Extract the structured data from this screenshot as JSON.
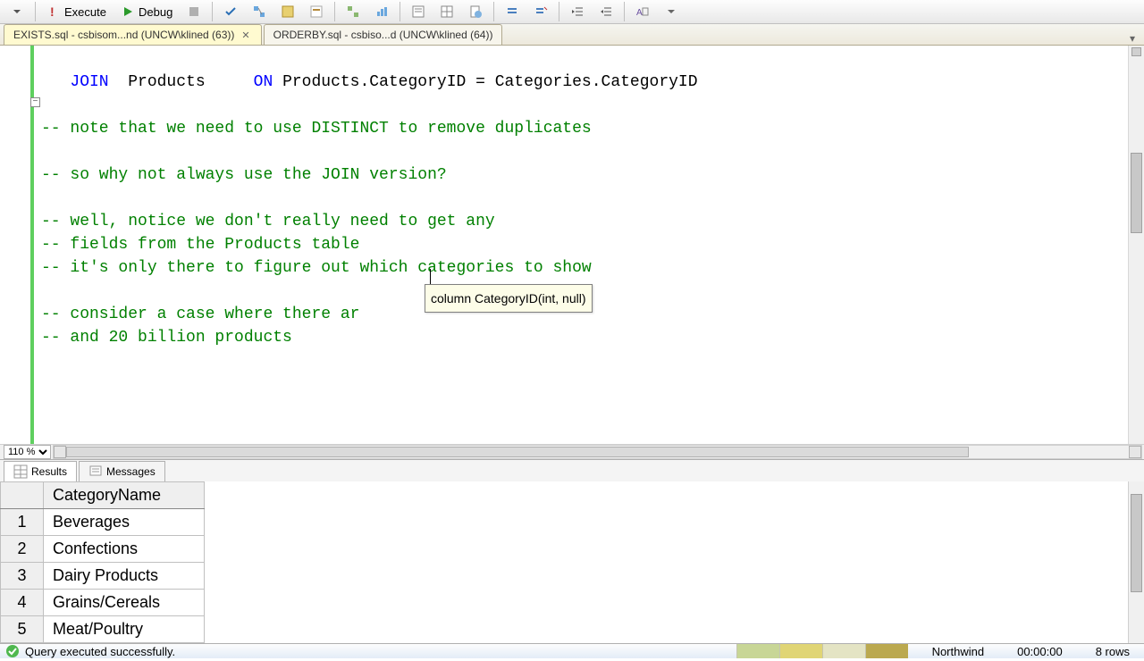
{
  "toolbar": {
    "execute": "Execute",
    "debug": "Debug"
  },
  "tabs": [
    {
      "label": "EXISTS.sql - csbisom...nd (UNCW\\klined (63))",
      "active": true
    },
    {
      "label": "ORDERBY.sql - csbiso...d (UNCW\\klined (64))",
      "active": false
    }
  ],
  "code": {
    "l1a": "   JOIN  ",
    "l1b": "Products     ",
    "l1c": "ON ",
    "l1d": "Products.CategoryID = Categories.CategoryID",
    "c2": "-- note that we need to use DISTINCT to remove duplicates",
    "c3": "-- so why not always use the JOIN version?",
    "c4": "-- well, notice we don't really need to get any",
    "c5": "-- fields from the Products table",
    "c6": "-- it's only there to figure out which categories to show",
    "c7": "-- consider a case where there ar",
    "c8": "-- and 20 billion products"
  },
  "tooltip": "column CategoryID(int, null)",
  "zoom": "110 %",
  "result_tabs": {
    "results": "Results",
    "messages": "Messages"
  },
  "grid": {
    "header": "CategoryName",
    "rows": [
      {
        "n": "1",
        "v": "Beverages"
      },
      {
        "n": "2",
        "v": "Confections"
      },
      {
        "n": "3",
        "v": "Dairy Products"
      },
      {
        "n": "4",
        "v": "Grains/Cereals"
      },
      {
        "n": "5",
        "v": "Meat/Poultry"
      }
    ]
  },
  "status": {
    "message": "Query executed successfully.",
    "chip_colors": [
      "#c8d696",
      "#e0d575",
      "#e4e4c4",
      "#bba94f"
    ],
    "db": "Northwind",
    "time": "00:00:00",
    "rows": "8 rows"
  }
}
